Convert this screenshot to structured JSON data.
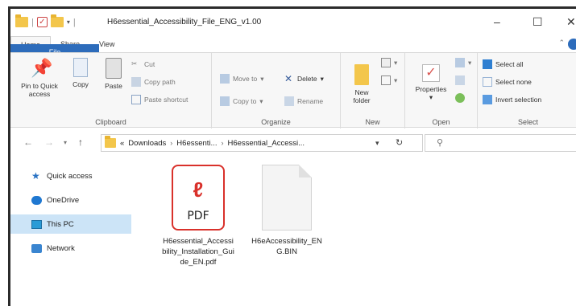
{
  "window": {
    "title": "H6essential_Accessibility_File_ENG_v1.00",
    "minimize": "–",
    "maximize": "☐",
    "close": "✕"
  },
  "ribbon_tabs": [
    "File",
    "Home",
    "Share",
    "View"
  ],
  "ribbon": {
    "clipboard": {
      "label": "Clipboard",
      "pin": "Pin to Quick access",
      "copy": "Copy",
      "paste": "Paste",
      "cut": "Cut",
      "copy_path": "Copy path",
      "paste_shortcut": "Paste shortcut"
    },
    "organize": {
      "label": "Organize",
      "move_to": "Move to",
      "delete": "Delete",
      "copy_to": "Copy to",
      "rename": "Rename"
    },
    "new": {
      "label": "New",
      "new_folder": "New folder"
    },
    "open": {
      "label": "Open",
      "properties": "Properties"
    },
    "select": {
      "label": "Select",
      "select_all": "Select all",
      "select_none": "Select none",
      "invert_selection": "Invert selection"
    }
  },
  "address": {
    "prefix": "«",
    "crumbs": [
      "Downloads",
      "H6essenti...",
      "H6essential_Accessi..."
    ],
    "separator": "›"
  },
  "navigation": {
    "items": [
      "Quick access",
      "OneDrive",
      "This PC",
      "Network"
    ]
  },
  "files": [
    {
      "name": "H6essential_Accessibility_Installation_Guide_EN.pdf",
      "icon_label": "PDF",
      "type": "pdf-icon"
    },
    {
      "name": "H6eAccessibility_ENG.BIN",
      "type": "generic-file-icon"
    }
  ]
}
